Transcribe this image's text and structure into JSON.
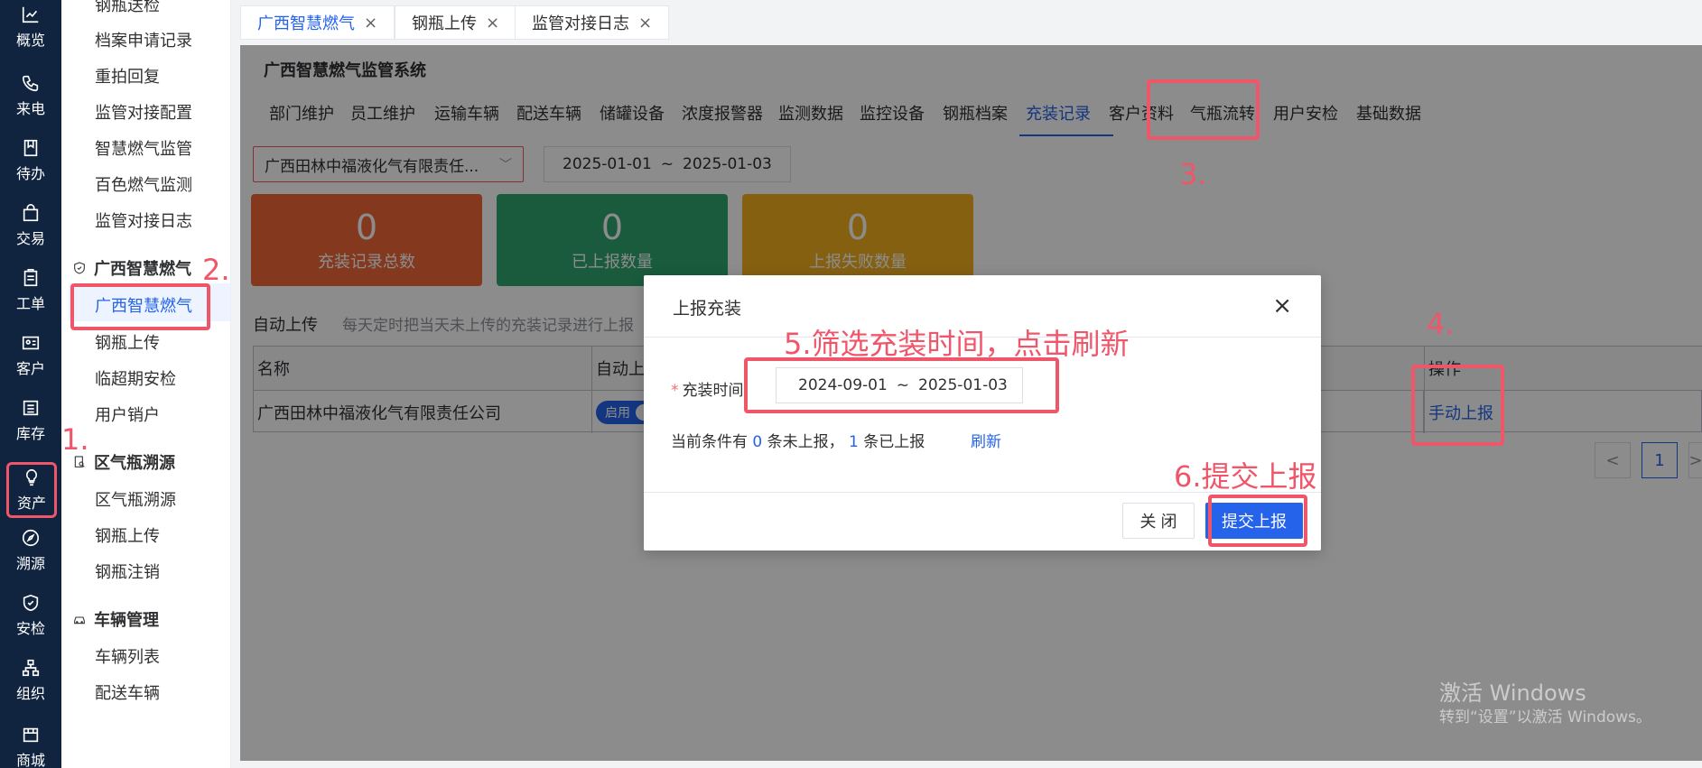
{
  "rail": [
    {
      "label": "概览",
      "icon": "chart-icon"
    },
    {
      "label": "来电",
      "icon": "phone-icon"
    },
    {
      "label": "待办",
      "icon": "bookmark-icon"
    },
    {
      "label": "交易",
      "icon": "bag-icon"
    },
    {
      "label": "工单",
      "icon": "clipboard-icon"
    },
    {
      "label": "客户",
      "icon": "id-card-icon"
    },
    {
      "label": "库存",
      "icon": "list-icon"
    },
    {
      "label": "资产",
      "icon": "bulb-icon"
    },
    {
      "label": "溯源",
      "icon": "compass-icon"
    },
    {
      "label": "安检",
      "icon": "shield-icon"
    },
    {
      "label": "组织",
      "icon": "org-icon"
    },
    {
      "label": "商城",
      "icon": "store-icon"
    }
  ],
  "sidebar": {
    "items_top": [
      "钢瓶送检",
      "档案申请记录",
      "重拍回复",
      "监管对接配置",
      "智慧燃气监管",
      "百色燃气监测",
      "监管对接日志"
    ],
    "group1": "广西智慧燃气",
    "group1_items": [
      "广西智慧燃气",
      "钢瓶上传",
      "临超期安检",
      "用户销户"
    ],
    "group2": "区气瓶溯源",
    "group2_items": [
      "区气瓶溯源",
      "钢瓶上传",
      "钢瓶注销"
    ],
    "group3": "车辆管理",
    "group3_items": [
      "车辆列表",
      "配送车辆"
    ]
  },
  "tabs": [
    "广西智慧燃气",
    "钢瓶上传",
    "监管对接日志"
  ],
  "system_title": "广西智慧燃气监管系统",
  "subnav": [
    "部门维护",
    "员工维护",
    "运输车辆",
    "配送车辆",
    "储罐设备",
    "浓度报警器",
    "监测数据",
    "监控设备",
    "钢瓶档案",
    "充装记录",
    "客户资料",
    "气瓶流转",
    "用户安检",
    "基础数据"
  ],
  "filter": {
    "company": "广西田林中福液化气有限责任...",
    "date_start": "2025-01-01",
    "date_sep": "~",
    "date_end": "2025-01-03"
  },
  "cards": [
    {
      "value": "0",
      "label": "充装记录总数",
      "color": "#f0683a"
    },
    {
      "value": "0",
      "label": "已上报数量",
      "color": "#2fa66e"
    },
    {
      "value": "0",
      "label": "上报失败数量",
      "color": "#f5b020"
    }
  ],
  "auto_upload": {
    "label": "自动上传",
    "desc": "每天定时把当天未上传的充装记录进行上报"
  },
  "table": {
    "col_name": "名称",
    "col_auto": "自动上",
    "col_op": "操作",
    "row_name": "广西田林中福液化气有限责任公司",
    "toggle_label": "启用",
    "row_op": "手动上报"
  },
  "pager": {
    "prev": "<",
    "page": "1",
    "next": ">"
  },
  "watermark": {
    "line1": "激活 Windows",
    "line2": "转到“设置”以激活 Windows。"
  },
  "modal": {
    "title": "上报充装",
    "close_icon": "×",
    "field_label": "充装时间:",
    "date_start": "2024-09-01",
    "date_sep": "~",
    "date_end": "2025-01-03",
    "cond_prefix": "当前条件有",
    "unreported_count": "0",
    "cond_mid": "条未上报，",
    "reported_count": "1",
    "cond_suffix": "条已上报",
    "refresh": "刷新",
    "btn_close": "关 闭",
    "btn_submit": "提交上报"
  },
  "annotations": {
    "a1": "1.",
    "a2": "2.",
    "a3": "3.",
    "a4": "4.",
    "a5": "5.筛选充装时间，点击刷新",
    "a6": "6.提交上报",
    "color": "#f0566a"
  }
}
